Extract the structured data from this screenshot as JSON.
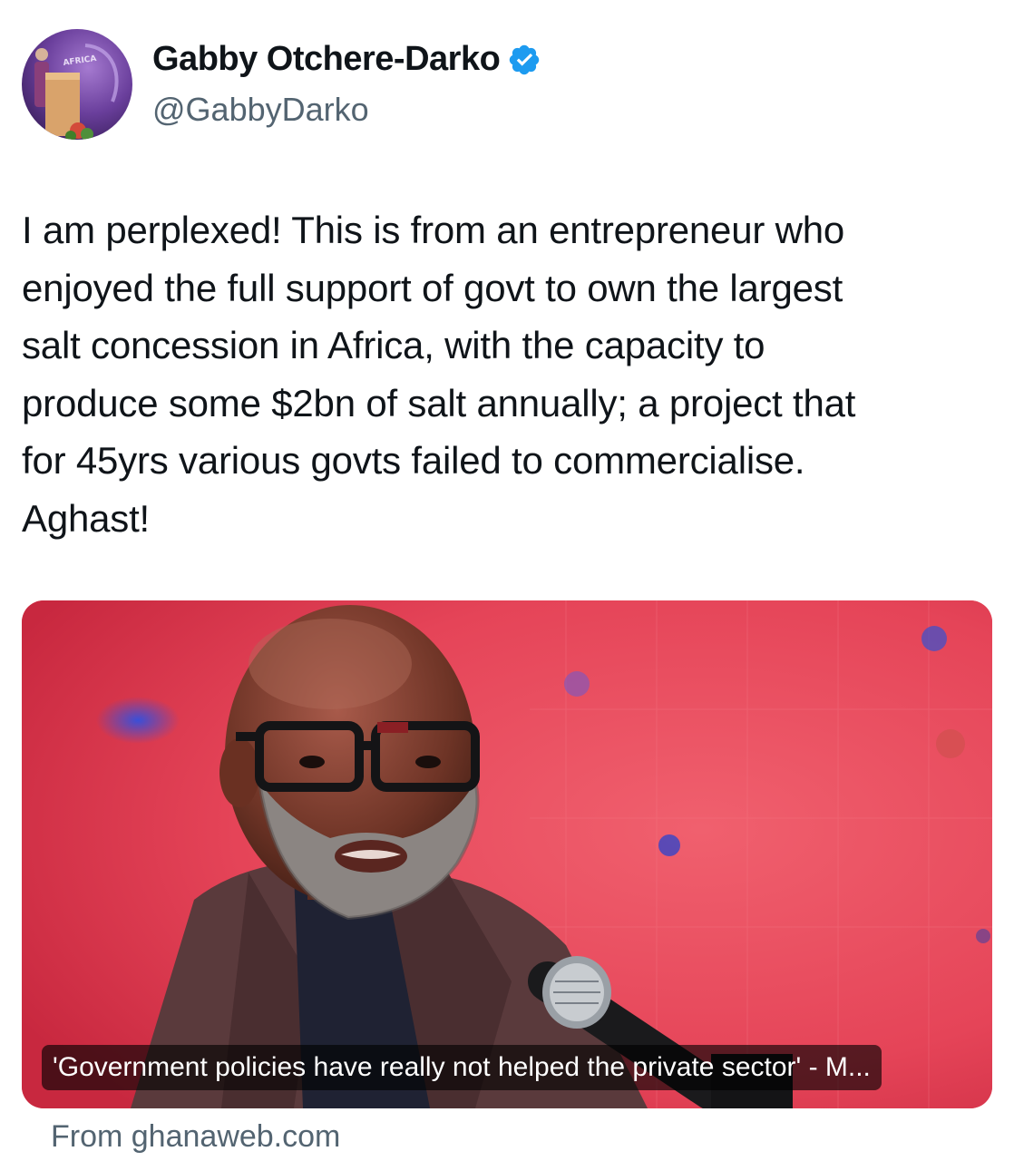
{
  "author": {
    "display_name": "Gabby Otchere-Darko",
    "handle": "@GabbyDarko",
    "verified": true,
    "avatar_icon": "avatar-photo-speaker-at-podium",
    "avatar_backdrop_text": "AFRICA"
  },
  "tweet": {
    "text": "I am perplexed! This is from an entrepreneur who\nenjoyed the full support of govt to own the largest\nsalt concession in Africa, with the capacity to\nproduce some $2bn of salt annually; a project that\nfor 45yrs various govts failed to commercialise.\nAghast!"
  },
  "link_card": {
    "image_icon": "photo-man-speaking-at-microphone",
    "caption": "'Government policies have really not helped the private sector' - M...",
    "source": "From ghanaweb.com"
  },
  "colors": {
    "verified_badge": "#1d9bf0",
    "handle_gray": "#536471",
    "text": "#0f1419",
    "card_background": "#e63f55"
  }
}
